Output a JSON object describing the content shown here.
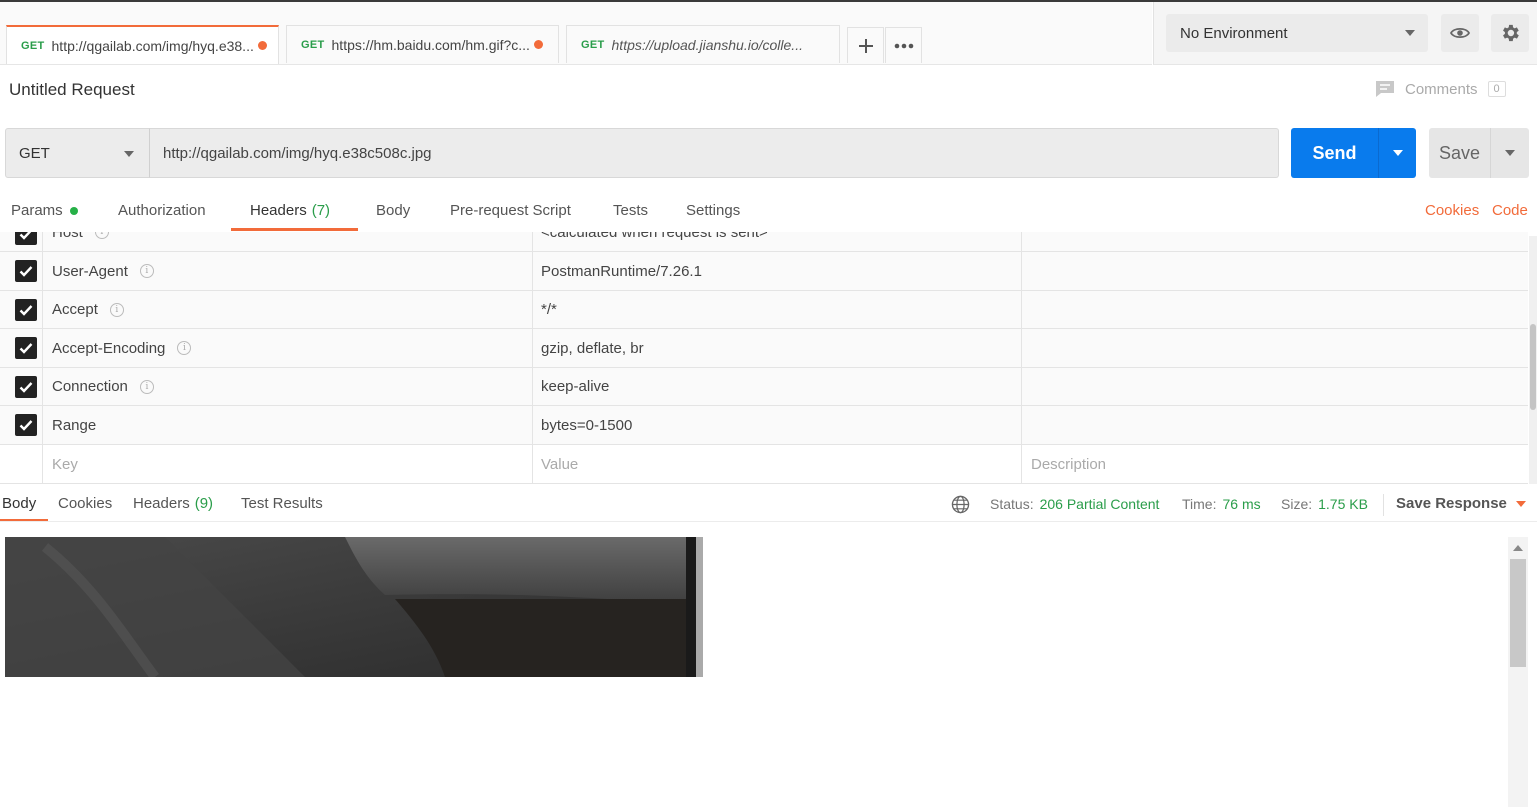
{
  "tabs": [
    {
      "method": "GET",
      "url": "http://qgailab.com/img/hyq.e38...",
      "unsaved": true
    },
    {
      "method": "GET",
      "url": "https://hm.baidu.com/hm.gif?c...",
      "unsaved": true
    },
    {
      "method": "GET",
      "url": "https://upload.jianshu.io/colle...",
      "unsaved": false
    }
  ],
  "tab_actions": {
    "add_icon": "plus-icon",
    "more_icon": "ellipsis-icon"
  },
  "environment": {
    "selected": "No Environment",
    "eye_icon": "eye-icon",
    "settings_icon": "gear-icon"
  },
  "request": {
    "title": "Untitled Request",
    "comments_label": "Comments",
    "comments_count": "0",
    "method": "GET",
    "url": "http://qgailab.com/img/hyq.e38c508c.jpg",
    "send_label": "Send",
    "save_label": "Save"
  },
  "request_tabs": {
    "params": "Params",
    "authorization": "Authorization",
    "headers": "Headers",
    "headers_count": "(7)",
    "body": "Body",
    "prerequest": "Pre-request Script",
    "tests": "Tests",
    "settings": "Settings",
    "cookies": "Cookies",
    "code": "Code"
  },
  "headers": {
    "rows": [
      {
        "key": "Host",
        "value": "<calculated when request is sent>",
        "checked": true,
        "info": true
      },
      {
        "key": "User-Agent",
        "value": "PostmanRuntime/7.26.1",
        "checked": true,
        "info": true
      },
      {
        "key": "Accept",
        "value": "*/*",
        "checked": true,
        "info": true
      },
      {
        "key": "Accept-Encoding",
        "value": "gzip, deflate, br",
        "checked": true,
        "info": true
      },
      {
        "key": "Connection",
        "value": "keep-alive",
        "checked": true,
        "info": true
      },
      {
        "key": "Range",
        "value": "bytes=0-1500",
        "checked": true,
        "info": false
      }
    ],
    "placeholder_key": "Key",
    "placeholder_value": "Value",
    "placeholder_description": "Description"
  },
  "response": {
    "tabs": {
      "body": "Body",
      "cookies": "Cookies",
      "headers": "Headers",
      "headers_count": "(9)",
      "test_results": "Test Results"
    },
    "status_label": "Status:",
    "status_value": "206 Partial Content",
    "time_label": "Time:",
    "time_value": "76 ms",
    "size_label": "Size:",
    "size_value": "1.75 KB",
    "save_response": "Save Response"
  },
  "colors": {
    "accent": "#f26b3a",
    "send": "#097bed",
    "success": "#2a9d4a"
  }
}
